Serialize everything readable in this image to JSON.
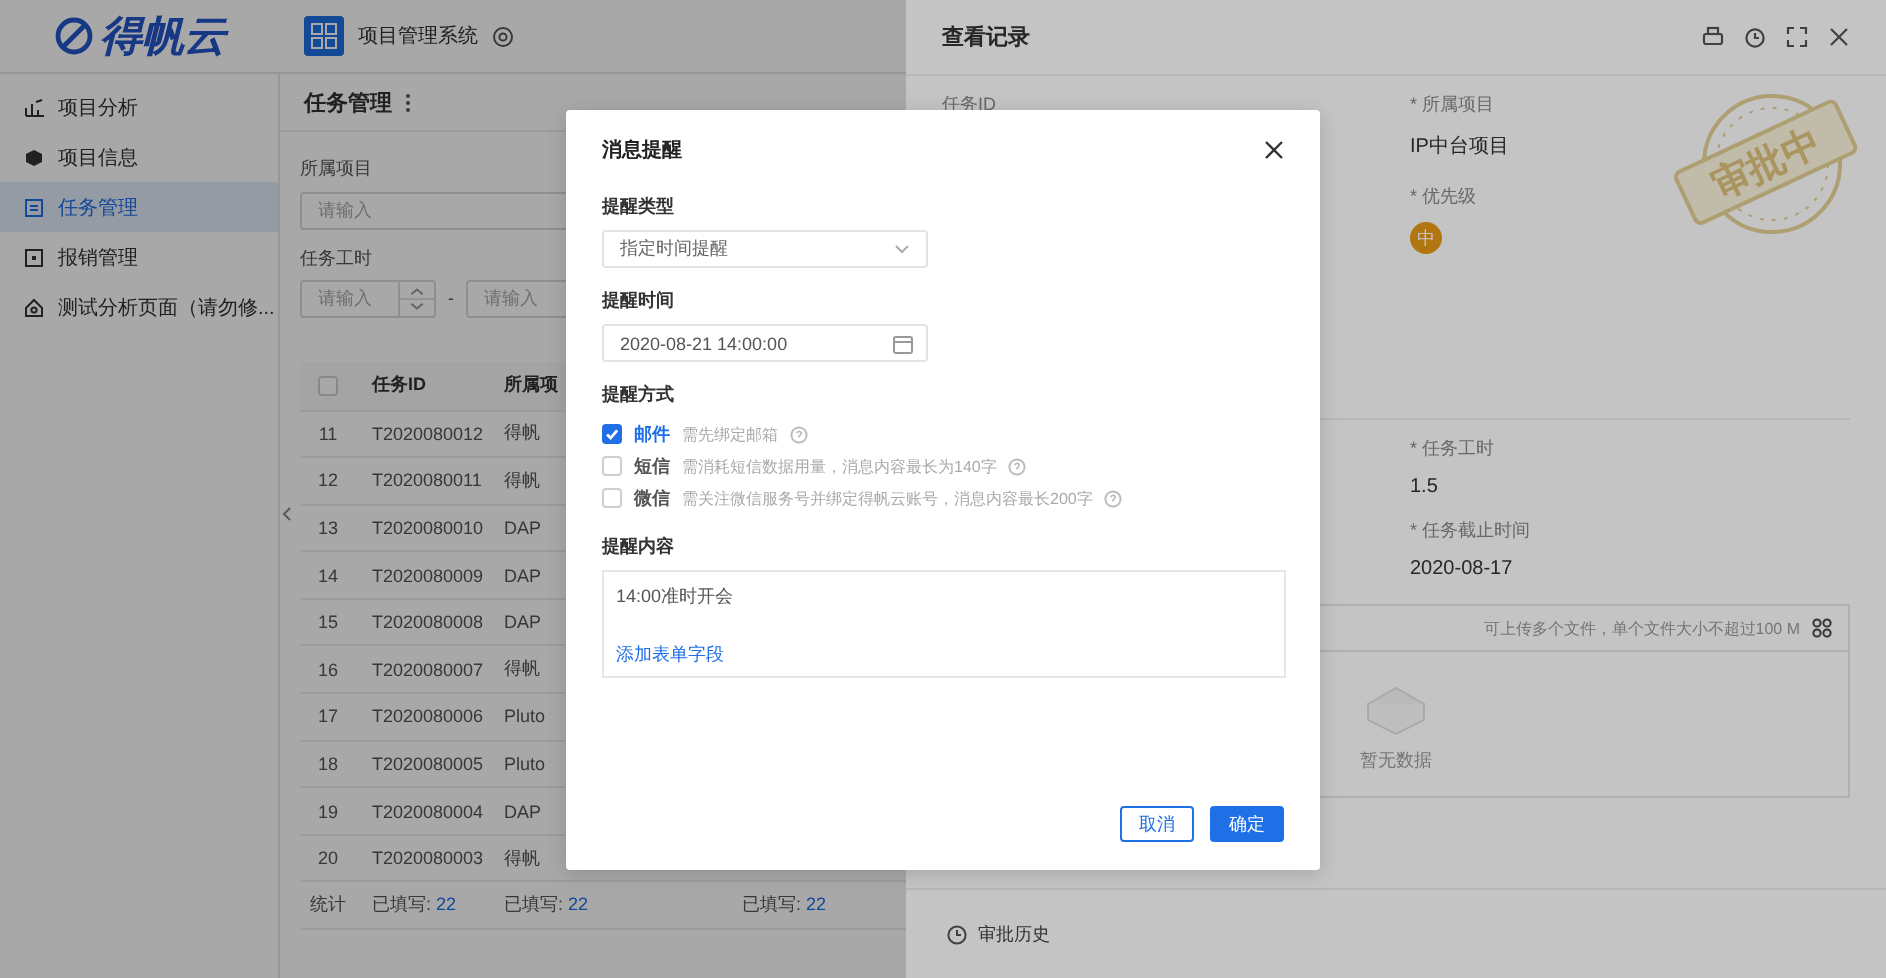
{
  "header": {
    "logo": "得帆云",
    "app_name": "项目管理系统"
  },
  "sidebar": {
    "items": [
      {
        "label": "项目分析",
        "selected": false
      },
      {
        "label": "项目信息",
        "selected": false
      },
      {
        "label": "任务管理",
        "selected": true
      },
      {
        "label": "报销管理",
        "selected": false
      },
      {
        "label": "测试分析页面（请勿修...",
        "selected": false
      }
    ]
  },
  "task_page": {
    "title": "任务管理",
    "filters": [
      {
        "kind": "text",
        "label": "所属项目",
        "placeholder": "请输入"
      },
      {
        "kind": "range",
        "label": "任务工时",
        "placeholder": "请输入",
        "separator": "-",
        "placeholder_end": "请输入"
      }
    ],
    "table": {
      "select_all_checked": false,
      "columns": [
        "任务ID",
        "所属项"
      ],
      "rows": [
        {
          "no": "11",
          "id": "T2020080012",
          "column_3": "得帆"
        },
        {
          "no": "12",
          "id": "T2020080011",
          "column_3": "得帆"
        },
        {
          "no": "13",
          "id": "T2020080010",
          "column_3": "DAP"
        },
        {
          "no": "14",
          "id": "T2020080009",
          "column_3": "DAP"
        },
        {
          "no": "15",
          "id": "T2020080008",
          "column_3": "DAP"
        },
        {
          "no": "16",
          "id": "T2020080007",
          "column_3": "得帆"
        },
        {
          "no": "17",
          "id": "T2020080006",
          "column_3": "Pluto"
        },
        {
          "no": "18",
          "id": "T2020080005",
          "column_3": "Pluto"
        },
        {
          "no": "19",
          "id": "T2020080004",
          "column_3": "DAP"
        },
        {
          "no": "20",
          "id": "T2020080003",
          "column_3": "得帆"
        }
      ],
      "footer": {
        "label": "统计",
        "cells": [
          {
            "label": "已填写:",
            "count": "22"
          },
          {
            "label": "已填写:",
            "count": "22"
          },
          {
            "label": "已填写:",
            "count": "22"
          }
        ]
      }
    }
  },
  "drawer": {
    "title": "查看记录",
    "stamp": "审批中",
    "fields": [
      {
        "kind": "text",
        "label": "任务ID"
      },
      {
        "kind": "text",
        "label": "* 所属项目",
        "value": "IP中台项目"
      },
      {
        "kind": "badge",
        "label": "* 优先级",
        "value": "中"
      },
      {
        "kind": "text",
        "label": "* 任务工时",
        "value": "1.5"
      },
      {
        "kind": "text",
        "label": "* 任务截止时间",
        "value": "2020-08-17"
      }
    ],
    "attachments": {
      "hint": "可上传多个文件，单个文件大小不超过100 M",
      "empty_text": "暂无数据"
    },
    "history_link": "审批历史"
  },
  "modal": {
    "title": "消息提醒",
    "fields": [
      {
        "kind": "select",
        "label": "提醒类型",
        "value": "指定时间提醒"
      },
      {
        "kind": "date",
        "label": "提醒时间",
        "value": "2020-08-21 14:00:00"
      },
      {
        "kind": "checks",
        "label": "提醒方式",
        "options": [
          {
            "label": "邮件",
            "hint": "需先绑定邮箱",
            "checked": true
          },
          {
            "label": "短信",
            "hint": "需消耗短信数据用量，消息内容最长为140字",
            "checked": false
          },
          {
            "label": "微信",
            "hint": "需关注微信服务号并绑定得帆云账号，消息内容最长200字",
            "checked": false
          }
        ]
      },
      {
        "kind": "textarea",
        "label": "提醒内容",
        "value": "14:00准时开会",
        "link": "添加表单字段"
      }
    ],
    "buttons": [
      {
        "label": "取消",
        "kind": "secondary"
      },
      {
        "label": "确定",
        "kind": "primary"
      }
    ]
  }
}
